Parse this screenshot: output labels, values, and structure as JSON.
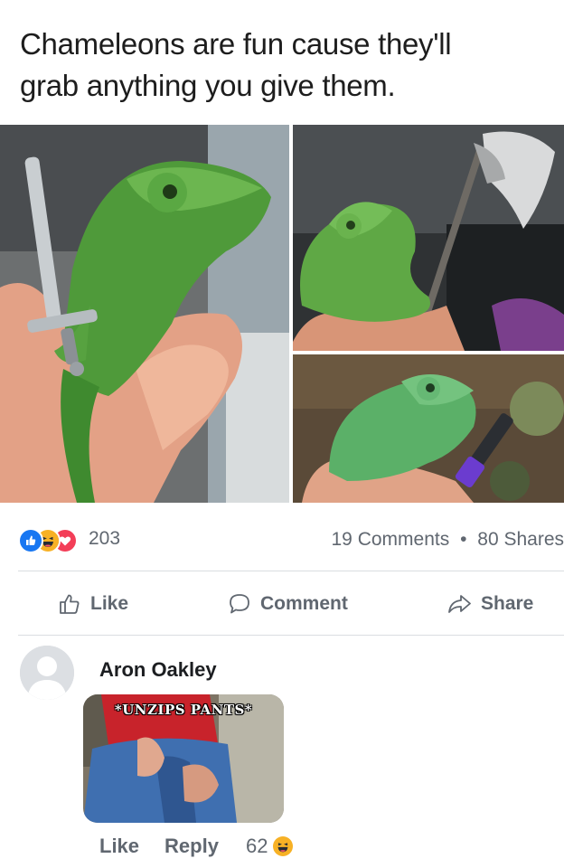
{
  "post": {
    "text_line1": "Chameleons are fun cause they'll",
    "text_line2": "grab anything you give them."
  },
  "stats": {
    "reaction_count": "203",
    "comments": "19 Comments",
    "separator": "•",
    "shares": "80 Shares",
    "reaction_icons": [
      "like-icon",
      "haha-icon",
      "love-icon"
    ]
  },
  "actions": {
    "like": "Like",
    "comment": "Comment",
    "share": "Share"
  },
  "comment": {
    "author": "Aron Oakley",
    "gif_caption": "*UNZIPS PANTS*",
    "like": "Like",
    "reply": "Reply",
    "reaction_count": "62",
    "reaction_icon": "haha-icon"
  },
  "colors": {
    "facebook_blue": "#1877f2",
    "love_red": "#f33e58",
    "haha_yellow": "#f7b125",
    "meta_gray": "#606770"
  }
}
